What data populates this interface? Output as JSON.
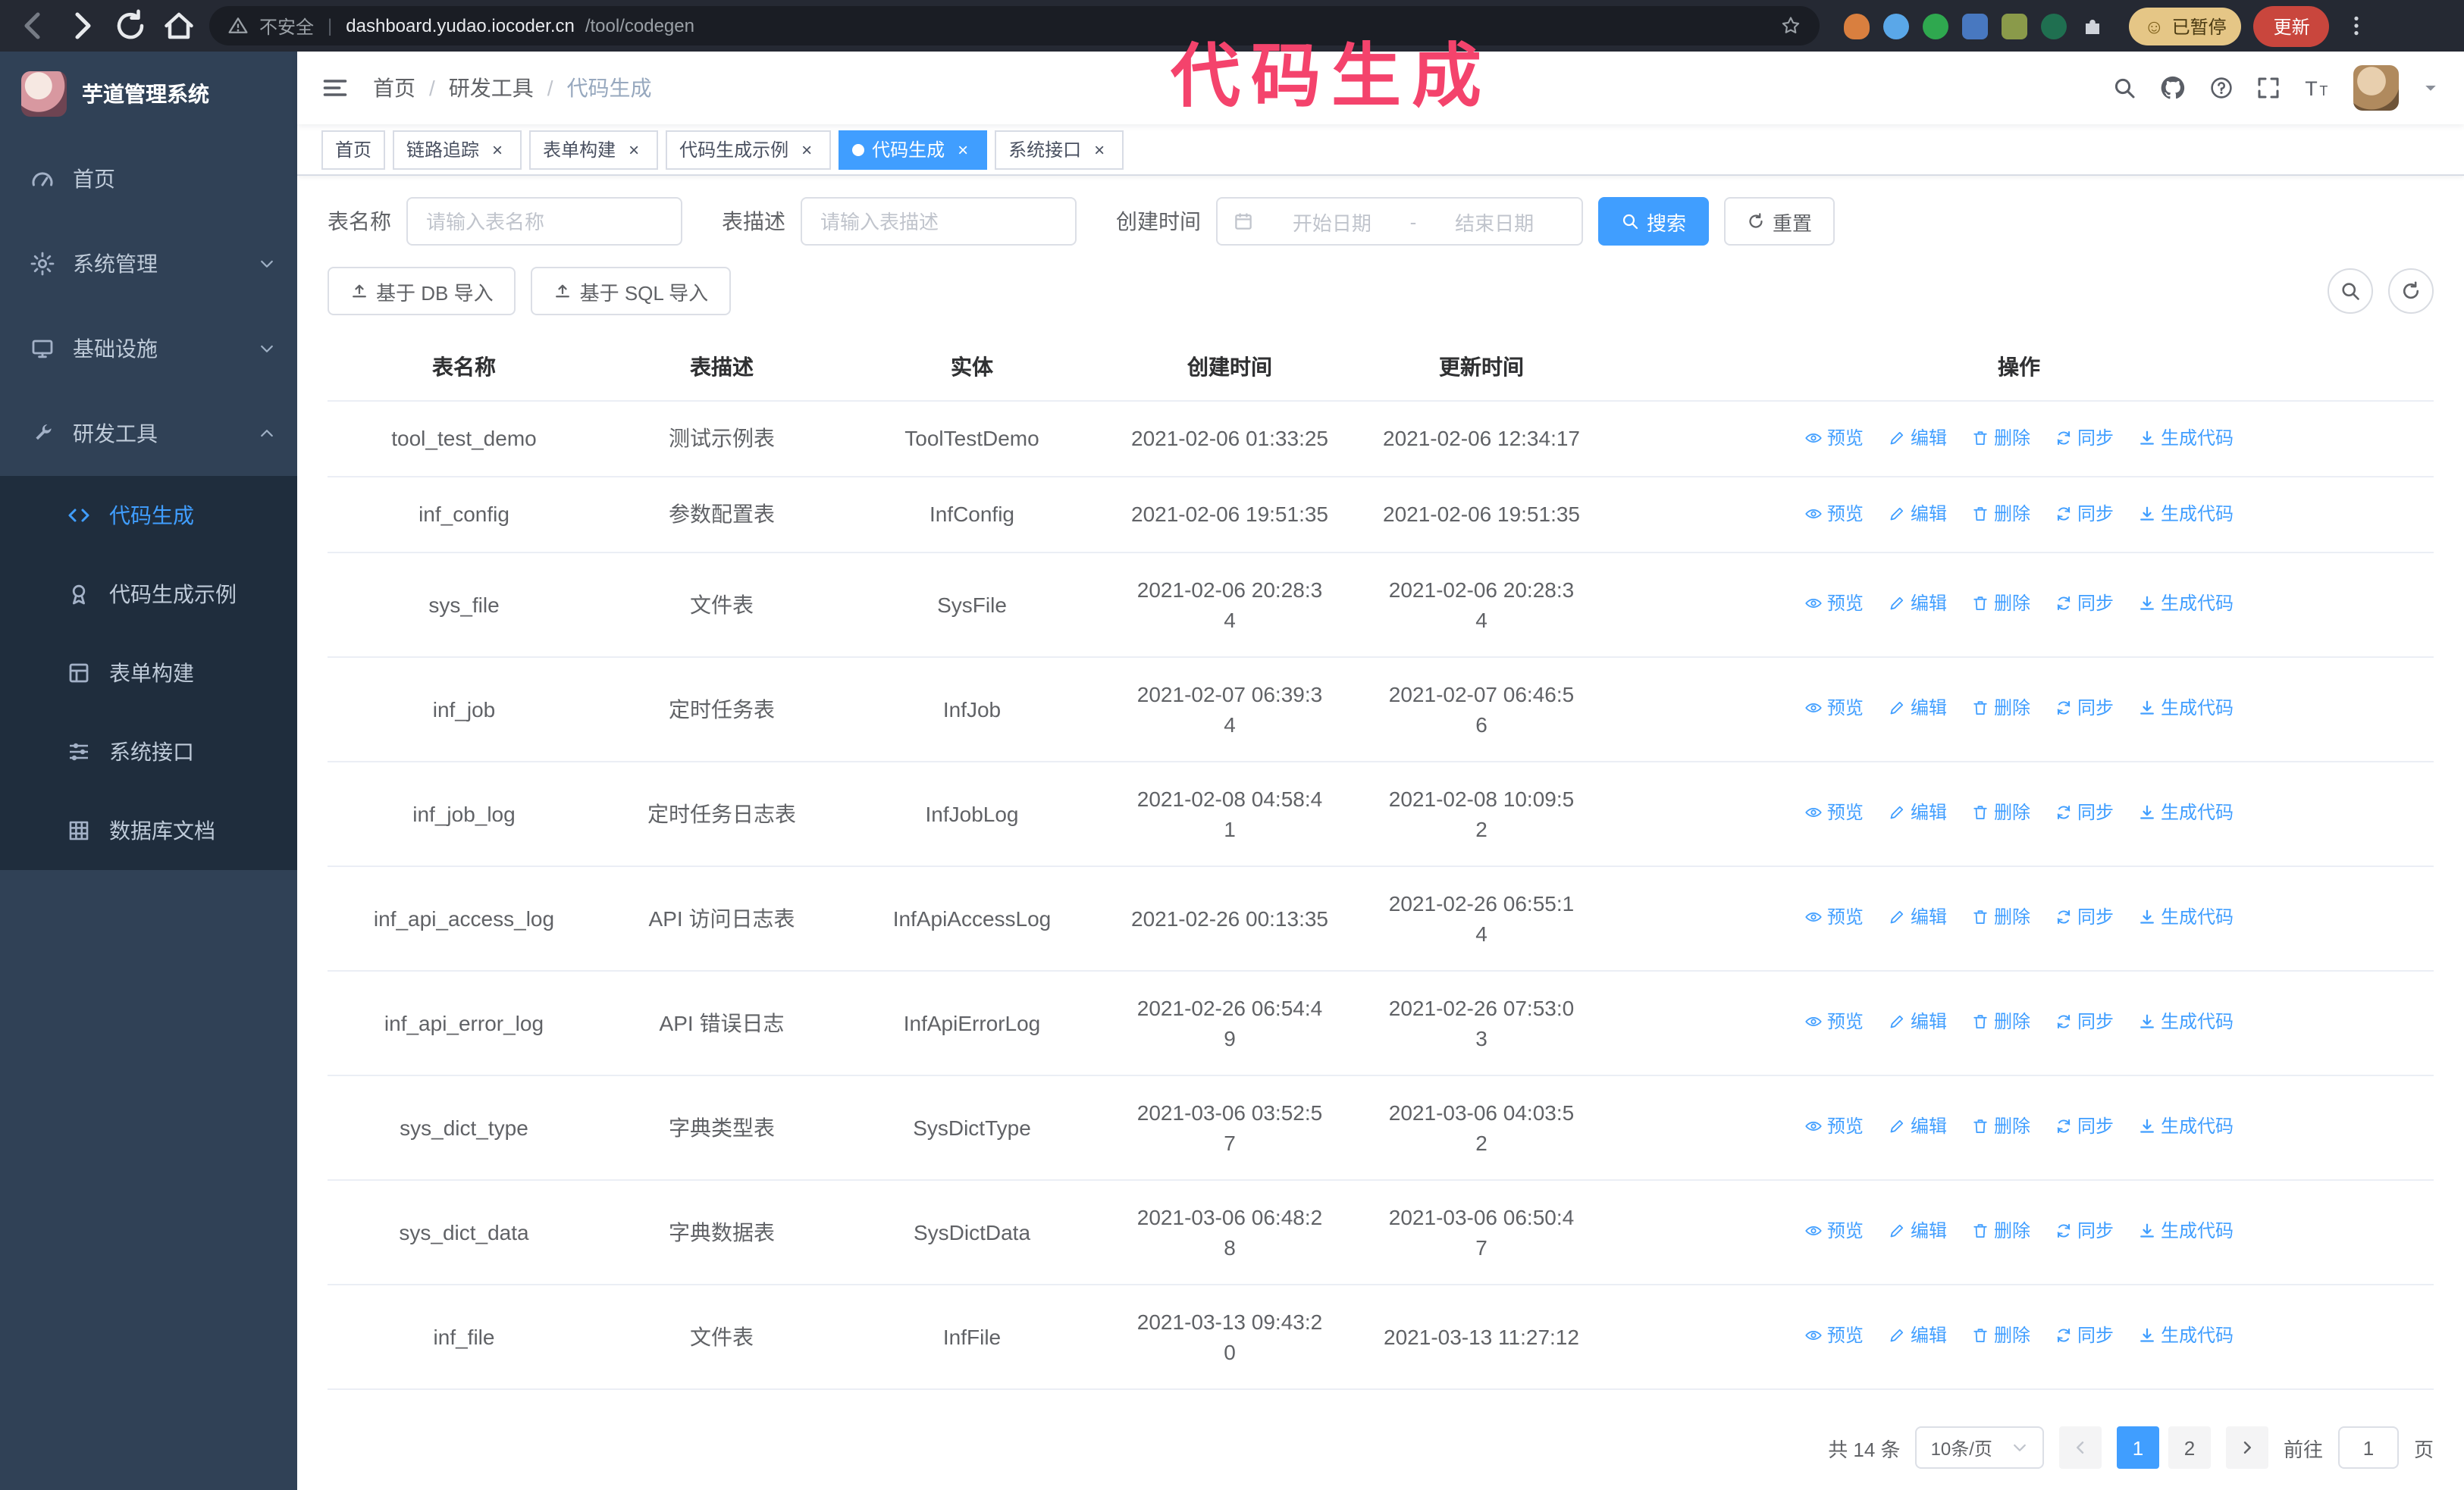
{
  "colors": {
    "accent": "#409eff",
    "annotation_pink": "#f4436c",
    "sidebar_bg": "#304156",
    "submenu_bg": "#1f2d3d",
    "chrome_bg": "#252933",
    "update_button_bg": "#c9463d",
    "paused_badge_bg": "#e5c686"
  },
  "browser": {
    "security_label": "不安全",
    "separator": "|",
    "url_host": "dashboard.yudao.iocoder.cn",
    "url_path": "/tool/codegen",
    "paused_badge": "已暂停",
    "update_button": "更新"
  },
  "annotation": "代码生成",
  "sidebar": {
    "logo_title": "芋道管理系统",
    "menu": [
      {
        "label": "首页",
        "icon": "gauge",
        "expandable": false,
        "open": false
      },
      {
        "label": "系统管理",
        "icon": "gear",
        "expandable": true,
        "open": false
      },
      {
        "label": "基础设施",
        "icon": "monitor",
        "expandable": true,
        "open": false
      },
      {
        "label": "研发工具",
        "icon": "tool",
        "expandable": true,
        "open": true,
        "children": [
          {
            "label": "代码生成",
            "icon": "code",
            "active": true
          },
          {
            "label": "代码生成示例",
            "icon": "medal",
            "active": false
          },
          {
            "label": "表单构建",
            "icon": "form",
            "active": false
          },
          {
            "label": "系统接口",
            "icon": "sliders",
            "active": false
          },
          {
            "label": "数据库文档",
            "icon": "grid",
            "active": false
          }
        ]
      }
    ]
  },
  "navbar": {
    "breadcrumb": [
      "首页",
      "研发工具",
      "代码生成"
    ],
    "breadcrumb_separator": "/"
  },
  "tabs": [
    {
      "label": "首页",
      "closable": false,
      "active": false
    },
    {
      "label": "链路追踪",
      "closable": true,
      "active": false
    },
    {
      "label": "表单构建",
      "closable": true,
      "active": false
    },
    {
      "label": "代码生成示例",
      "closable": true,
      "active": false
    },
    {
      "label": "代码生成",
      "closable": true,
      "active": true
    },
    {
      "label": "系统接口",
      "closable": true,
      "active": false
    }
  ],
  "filters": {
    "table_name_label": "表名称",
    "table_name_placeholder": "请输入表名称",
    "table_desc_label": "表描述",
    "table_desc_placeholder": "请输入表描述",
    "create_time_label": "创建时间",
    "date_start_placeholder": "开始日期",
    "date_separator": "-",
    "date_end_placeholder": "结束日期",
    "search_button": "搜索",
    "reset_button": "重置"
  },
  "toolbar": {
    "import_db": "基于 DB 导入",
    "import_sql": "基于 SQL 导入"
  },
  "table": {
    "columns": [
      "表名称",
      "表描述",
      "实体",
      "创建时间",
      "更新时间",
      "操作"
    ],
    "action_labels": [
      "预览",
      "编辑",
      "删除",
      "同步",
      "生成代码"
    ],
    "rows": [
      {
        "name": "tool_test_demo",
        "desc": "测试示例表",
        "entity": "ToolTestDemo",
        "created": "2021-02-06 01:33:25",
        "updated": "2021-02-06 12:34:17",
        "created_wrap": false,
        "updated_wrap": false
      },
      {
        "name": "inf_config",
        "desc": "参数配置表",
        "entity": "InfConfig",
        "created": "2021-02-06 19:51:35",
        "updated": "2021-02-06 19:51:35",
        "created_wrap": false,
        "updated_wrap": false
      },
      {
        "name": "sys_file",
        "desc": "文件表",
        "entity": "SysFile",
        "created": "2021-02-06 20:28:34",
        "updated": "2021-02-06 20:28:34",
        "created_wrap": true,
        "updated_wrap": true
      },
      {
        "name": "inf_job",
        "desc": "定时任务表",
        "entity": "InfJob",
        "created": "2021-02-07 06:39:34",
        "updated": "2021-02-07 06:46:56",
        "created_wrap": true,
        "updated_wrap": true
      },
      {
        "name": "inf_job_log",
        "desc": "定时任务日志表",
        "entity": "InfJobLog",
        "created": "2021-02-08 04:58:41",
        "updated": "2021-02-08 10:09:52",
        "created_wrap": true,
        "updated_wrap": true
      },
      {
        "name": "inf_api_access_log",
        "desc": "API 访问日志表",
        "entity": "InfApiAccessLog",
        "created": "2021-02-26 00:13:35",
        "updated": "2021-02-26 06:55:14",
        "created_wrap": false,
        "updated_wrap": true
      },
      {
        "name": "inf_api_error_log",
        "desc": "API 错误日志",
        "entity": "InfApiErrorLog",
        "created": "2021-02-26 06:54:49",
        "updated": "2021-02-26 07:53:03",
        "created_wrap": true,
        "updated_wrap": true
      },
      {
        "name": "sys_dict_type",
        "desc": "字典类型表",
        "entity": "SysDictType",
        "created": "2021-03-06 03:52:57",
        "updated": "2021-03-06 04:03:52",
        "created_wrap": true,
        "updated_wrap": true
      },
      {
        "name": "sys_dict_data",
        "desc": "字典数据表",
        "entity": "SysDictData",
        "created": "2021-03-06 06:48:28",
        "updated": "2021-03-06 06:50:47",
        "created_wrap": true,
        "updated_wrap": true
      },
      {
        "name": "inf_file",
        "desc": "文件表",
        "entity": "InfFile",
        "created": "2021-03-13 09:43:20",
        "updated": "2021-03-13 11:27:12",
        "created_wrap": true,
        "updated_wrap": false
      }
    ]
  },
  "pagination": {
    "total": "共 14 条",
    "page_size": "10条/页",
    "pages": [
      "1",
      "2"
    ],
    "current_page": "1",
    "goto_label": "前往",
    "goto_value": "1",
    "page_label": "页"
  }
}
